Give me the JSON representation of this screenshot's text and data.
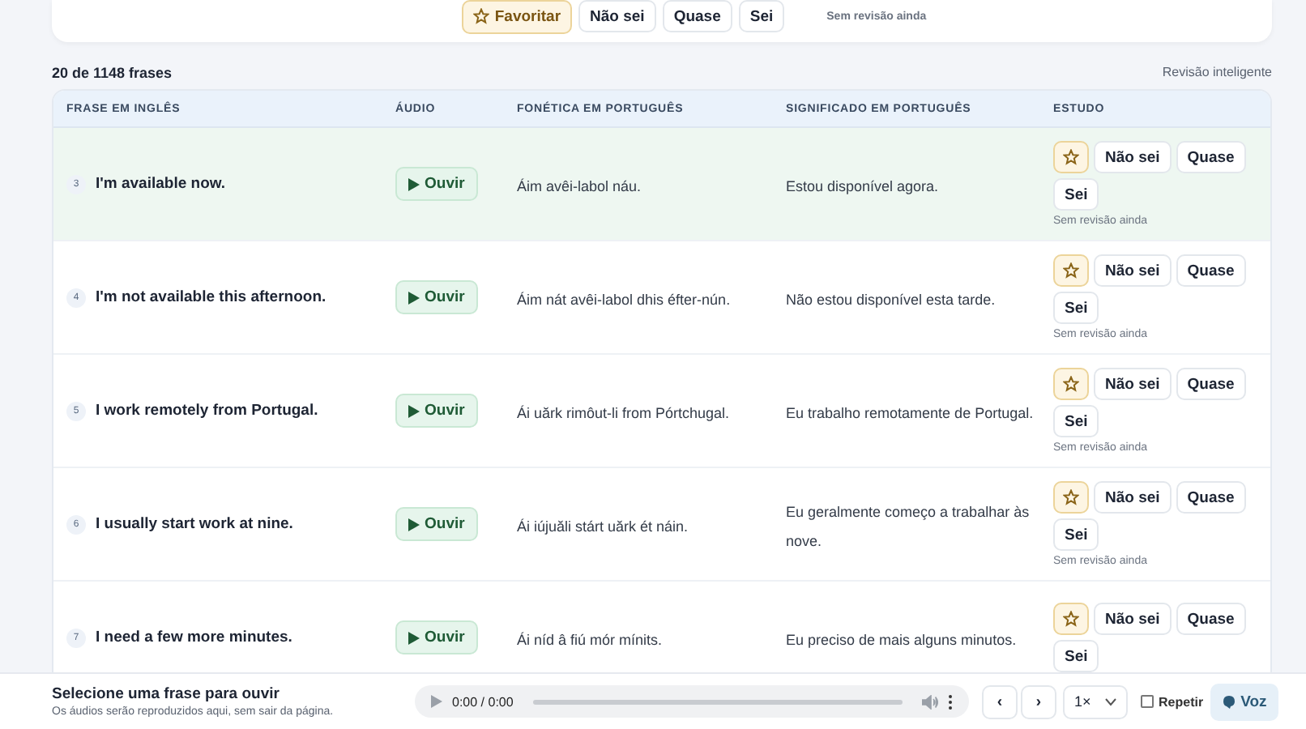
{
  "top_card": {
    "favorite": {
      "label": "Favoritar",
      "favorited": false
    },
    "ratings": [
      "Não sei",
      "Quase",
      "Sei"
    ],
    "review": "Sem revisão ainda"
  },
  "list_header": {
    "count": "20 de 1148 frases",
    "mode": "Revisão inteligente"
  },
  "table": {
    "columns": [
      "FRASE EM INGLÊS",
      "ÁUDIO",
      "FONÉTICA EM PORTUGUÊS",
      "SIGNIFICADO EM PORTUGUÊS",
      "ESTUDO"
    ],
    "rows": [
      {
        "number": "3",
        "phrase": "I'm available now.",
        "audio": "Ouvir",
        "phonetic": "Áim avêi-labol náu.",
        "meaning": "Estou disponível agora.",
        "favorited": false,
        "ratings": [
          "Não sei",
          "Quase",
          "Sei"
        ],
        "review": "Sem revisão ainda",
        "selected": true
      },
      {
        "number": "4",
        "phrase": "I'm not available this afternoon.",
        "audio": "Ouvir",
        "phonetic": "Áim nát avêi-labol dhis éfter-nún.",
        "meaning": "Não estou disponível esta tarde.",
        "favorited": false,
        "ratings": [
          "Não sei",
          "Quase",
          "Sei"
        ],
        "review": "Sem revisão ainda",
        "selected": false
      },
      {
        "number": "5",
        "phrase": "I work remotely from Portugal.",
        "audio": "Ouvir",
        "phonetic": "Ái uărk rimôut-li from Pórtchugal.",
        "meaning": "Eu trabalho remotamente de Portugal.",
        "favorited": false,
        "ratings": [
          "Não sei",
          "Quase",
          "Sei"
        ],
        "review": "Sem revisão ainda",
        "selected": false
      },
      {
        "number": "6",
        "phrase": "I usually start work at nine.",
        "audio": "Ouvir",
        "phonetic": "Ái iújuăli stárt uărk ét náin.",
        "meaning": "Eu geralmente começo a trabalhar às nove.",
        "favorited": false,
        "ratings": [
          "Não sei",
          "Quase",
          "Sei"
        ],
        "review": "Sem revisão ainda",
        "selected": false
      },
      {
        "number": "7",
        "phrase": "I need a few more minutes.",
        "audio": "Ouvir",
        "phonetic": "Ái níd â fiú mór mínits.",
        "meaning": "Eu preciso de mais alguns minutos.",
        "favorited": false,
        "ratings": [
          "Não sei",
          "Quase",
          "Sei"
        ],
        "selected": false
      }
    ]
  },
  "player": {
    "title": "Selecione uma frase para ouvir",
    "subtitle": "Os áudios serão reproduzidos aqui, sem sair da página.",
    "time": "0:00 / 0:00",
    "prev": "‹",
    "next": "›",
    "speed": "1×",
    "repeat": {
      "label": "Repetir",
      "checked": false
    },
    "voice": "Voz"
  }
}
